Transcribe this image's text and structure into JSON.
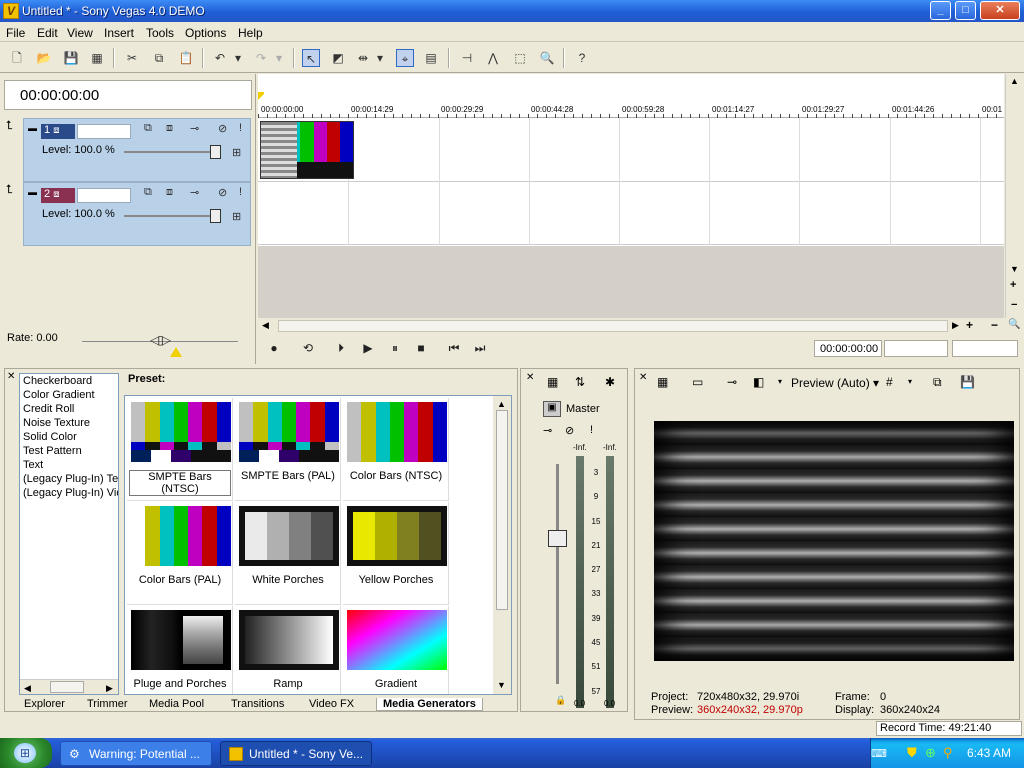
{
  "window": {
    "title": "Untitled * - Sony Vegas 4.0 DEMO"
  },
  "menu": [
    "File",
    "Edit",
    "View",
    "Insert",
    "Tools",
    "Options",
    "Help"
  ],
  "timeline": {
    "timecode": "00:00:00:00",
    "ruler_labels": [
      "00:00:00:00",
      "00:00:14:29",
      "00:00:29:29",
      "00:00:44:28",
      "00:00:59:28",
      "00:01:14:27",
      "00:01:29:27",
      "00:01:44:26",
      "00:01"
    ],
    "tracks": [
      {
        "number": "1",
        "level": "Level: 100.0 %"
      },
      {
        "number": "2",
        "level": "Level: 100.0 %"
      }
    ],
    "rate": "Rate: 0.00",
    "transport_timecode": "00:00:00:00"
  },
  "media_generators": {
    "list": [
      "Checkerboard",
      "Color Gradient",
      "Credit Roll",
      "Noise Texture",
      "Solid Color",
      "Test Pattern",
      "Text",
      "(Legacy Plug-In) Tex",
      "(Legacy Plug-In) Vid"
    ],
    "preset_label": "Preset:",
    "presets": [
      "SMPTE Bars (NTSC)",
      "SMPTE Bars (PAL)",
      "Color Bars (NTSC)",
      "Color Bars (PAL)",
      "White Porches",
      "Yellow Porches",
      "Pluge and Porches",
      "Ramp",
      "Gradient"
    ]
  },
  "tabs": [
    "Explorer",
    "Trimmer",
    "Media Pool",
    "Transitions",
    "Video FX",
    "Media Generators"
  ],
  "mixer": {
    "label": "Master",
    "inf_left": "-Inf.",
    "inf_right": "-Inf.",
    "scale": [
      "3",
      "9",
      "15",
      "21",
      "27",
      "33",
      "39",
      "45",
      "51",
      "57"
    ],
    "bottom_left": "0.0",
    "bottom_right": "0.0"
  },
  "preview": {
    "mode": "Preview (Auto)",
    "project_label": "Project:",
    "project_value": "720x480x32, 29.970i",
    "preview_label": "Preview:",
    "preview_value": "360x240x32, 29.970p",
    "frame_label": "Frame:",
    "frame_value": "0",
    "display_label": "Display:",
    "display_value": "360x240x24",
    "record_time": "Record Time: 49:21:40"
  },
  "taskbar": {
    "items": [
      "Warning: Potential ...",
      "Untitled * - Sony Ve..."
    ],
    "clock": "6:43 AM"
  },
  "colors": {
    "accent": "#316ac5",
    "track_header": "#b8d0e8"
  }
}
